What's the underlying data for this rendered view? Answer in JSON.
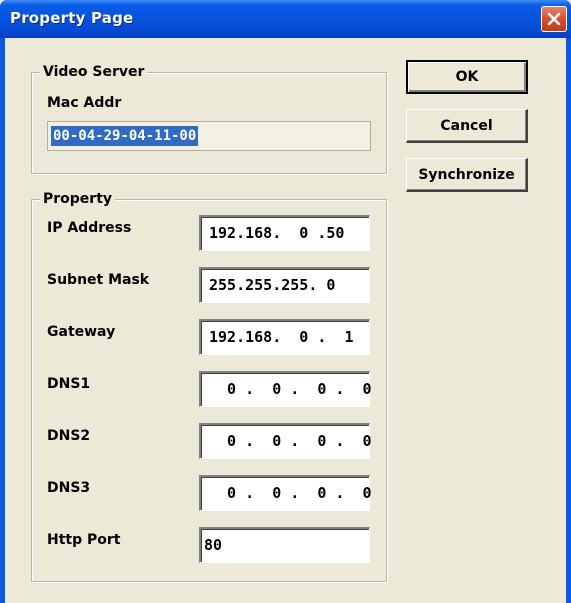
{
  "window": {
    "title": "Property Page"
  },
  "video_server": {
    "legend": "Video Server",
    "mac_label": "Mac Addr",
    "mac_value": "00-04-29-04-11-00"
  },
  "property": {
    "legend": "Property",
    "fields": [
      {
        "label": "IP Address",
        "value": "192.168.  0 .50"
      },
      {
        "label": "Subnet Mask",
        "value": "255.255.255. 0"
      },
      {
        "label": "Gateway",
        "value": "192.168.  0 .  1"
      },
      {
        "label": "DNS1",
        "value": "  0 .  0 .  0 .  0"
      },
      {
        "label": "DNS2",
        "value": "  0 .  0 .  0 .  0"
      },
      {
        "label": "DNS3",
        "value": "  0 .  0 .  0 .  0"
      },
      {
        "label": "Http Port",
        "value": "80"
      }
    ]
  },
  "buttons": {
    "ok": "OK",
    "cancel": "Cancel",
    "synchronize": "Synchronize"
  },
  "colors": {
    "titlebar": "#0653dc",
    "dialog_bg": "#ece9d8",
    "selection": "#316ac5",
    "close_button": "#d14c2c"
  },
  "icons": {
    "close": "close-icon"
  }
}
